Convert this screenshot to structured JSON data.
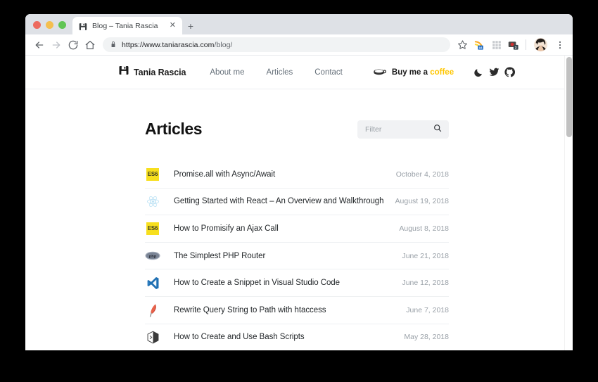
{
  "browser": {
    "tab": {
      "title": "Blog – Tania Rascia",
      "favicon": "floppy-disk-icon",
      "close_label": "✕"
    },
    "new_tab_label": "+",
    "toolbar": {
      "back_label": "←",
      "forward_label": "→",
      "reload_label": "⟳",
      "home_label": "⌂",
      "url_domain": "https://www.taniarascia.com",
      "url_path": "/blog/",
      "lock_icon": "lock-icon",
      "bookmark_label": "☆",
      "menu_label": "⋮",
      "extensions": [
        {
          "name": "rss-calendar-extension-icon",
          "badge": "16"
        },
        {
          "name": "grid-extension-icon",
          "badge": ""
        },
        {
          "name": "camera-extension-icon",
          "badge": "2"
        }
      ],
      "profile_name": "avatar"
    }
  },
  "site": {
    "brand": {
      "icon": "floppy-disk-icon",
      "name": "Tania Rascia"
    },
    "nav": [
      {
        "label": "About me"
      },
      {
        "label": "Articles"
      },
      {
        "label": "Contact"
      }
    ],
    "coffee": {
      "icon": "coffee-cup-icon",
      "text_before": "Buy me a ",
      "text_highlight": "coffee",
      "highlight_color": "#ffc600"
    },
    "icon_buttons": [
      {
        "name": "dark-mode-toggle",
        "icon": "moon-icon"
      },
      {
        "name": "twitter-link",
        "icon": "twitter-icon"
      },
      {
        "name": "github-link",
        "icon": "github-icon"
      }
    ]
  },
  "main": {
    "title": "Articles",
    "filter": {
      "placeholder": "Filter",
      "value": "",
      "icon": "search-icon"
    },
    "articles": [
      {
        "icon": "es6-icon",
        "title": "Promise.all with Async/Await",
        "date": "October 4, 2018"
      },
      {
        "icon": "react-icon",
        "title": "Getting Started with React – An Overview and Walkthrough",
        "date": "August 19, 2018"
      },
      {
        "icon": "es6-icon",
        "title": "How to Promisify an Ajax Call",
        "date": "August 8, 2018"
      },
      {
        "icon": "php-icon",
        "title": "The Simplest PHP Router",
        "date": "June 21, 2018"
      },
      {
        "icon": "vscode-icon",
        "title": "How to Create a Snippet in Visual Studio Code",
        "date": "June 12, 2018"
      },
      {
        "icon": "apache-icon",
        "title": "Rewrite Query String to Path with htaccess",
        "date": "June 7, 2018"
      },
      {
        "icon": "bash-icon",
        "title": "How to Create and Use Bash Scripts",
        "date": "May 28, 2018"
      }
    ]
  }
}
